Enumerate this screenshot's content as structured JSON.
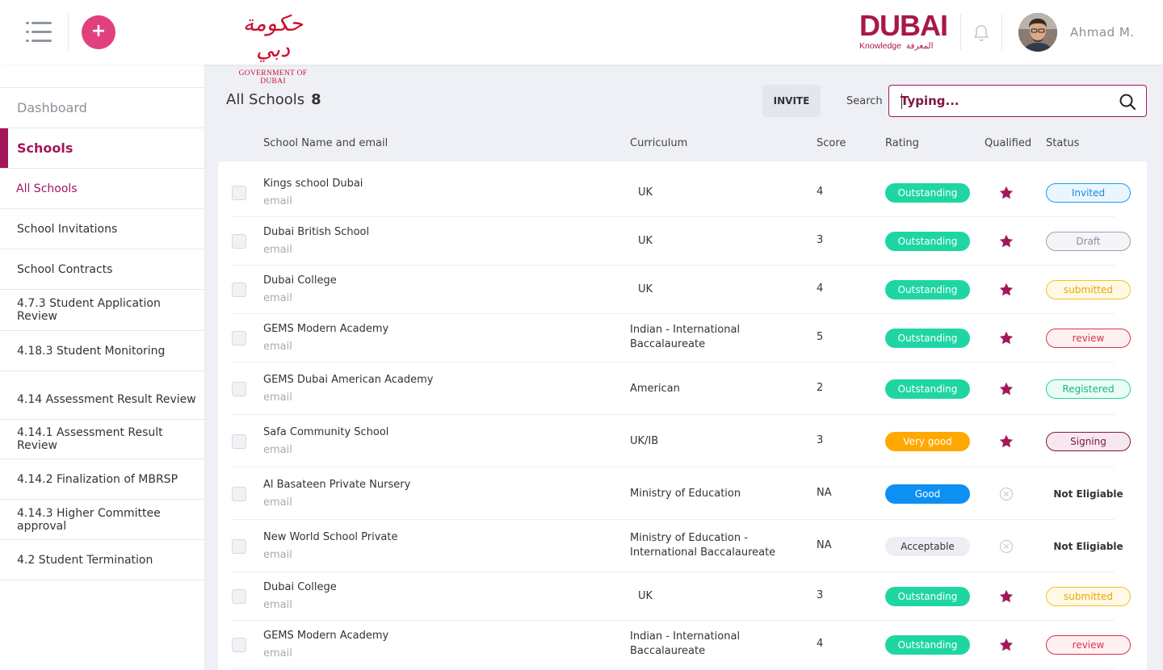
{
  "header": {
    "gov_logo_arabic": "حكومة دبي",
    "gov_logo_text": "GOVERNMENT OF DUBAI",
    "dubai_logo_text": "DUBAI",
    "dubai_logo_sub_en": "Knowledge",
    "dubai_logo_sub_ar": "المعرفة",
    "user_name": "Ahmad M.",
    "add_label": "+"
  },
  "sidebar": {
    "dashboard": "Dashboard",
    "schools": "Schools",
    "items": [
      "All Schools",
      "School Invitations",
      "School Contracts",
      "4.7.3 Student Application Review",
      "4.18.3 Student Monitoring",
      "4.14 Assessment Result Review",
      "4.14.1 Assessment Result Review",
      "4.14.2 Finalization of MBRSP",
      "4.14.3 Higher Committee approval",
      "4.2 Student Termination"
    ]
  },
  "main": {
    "title": "All Schools",
    "count": "8",
    "invite_label": "INVITE",
    "search_label": "Search",
    "search_placeholder": "Typing...",
    "columns": [
      "School Name and email",
      "Curriculum",
      "Score",
      "Rating",
      "Qualified",
      "Status"
    ]
  },
  "colors": {
    "accent": "#a3165a",
    "add_button": "#e0417e",
    "outstanding": "#1fd6a2",
    "very_good": "#ffa800",
    "good": "#0e8ff2",
    "acceptable": "#eceef4",
    "star": "#a3165a"
  },
  "rows": [
    {
      "name": "Kings school Dubai",
      "email": "email",
      "curriculum": "UK",
      "score": "4",
      "rating": "Outstanding",
      "qualified": "star",
      "status": "Invited"
    },
    {
      "name": "Dubai British School",
      "email": "email",
      "curriculum": "UK",
      "score": "3",
      "rating": "Outstanding",
      "qualified": "star",
      "status": "Draft"
    },
    {
      "name": "Dubai College",
      "email": "email",
      "curriculum": "UK",
      "score": "4",
      "rating": "Outstanding",
      "qualified": "star",
      "status": "submitted"
    },
    {
      "name": "GEMS Modern Academy",
      "email": "email",
      "curriculum": "Indian - International Baccalaureate",
      "score": "5",
      "rating": "Outstanding",
      "qualified": "star",
      "status": "review"
    },
    {
      "name": "GEMS Dubai American Academy",
      "email": "email",
      "curriculum": "American",
      "score": "2",
      "rating": "Outstanding",
      "qualified": "star",
      "status": "Registered"
    },
    {
      "name": "Safa Community School",
      "email": "email",
      "curriculum": "UK/IB",
      "score": "3",
      "rating": "Very good",
      "qualified": "star",
      "status": "Signing"
    },
    {
      "name": "Al Basateen Private Nursery",
      "email": "email",
      "curriculum": "Ministry of Education",
      "score": "NA",
      "rating": "Good",
      "qualified": "not-qualified",
      "status": "Not Eligiable"
    },
    {
      "name": "New World School Private",
      "email": "email",
      "curriculum": "Ministry of Education - International Baccalaureate",
      "score": "NA",
      "rating": "Acceptable",
      "qualified": "not-qualified",
      "status": "Not Eligiable"
    },
    {
      "name": "Dubai College",
      "email": "email",
      "curriculum": "UK",
      "score": "3",
      "rating": "Outstanding",
      "qualified": "star",
      "status": "submitted"
    },
    {
      "name": "GEMS Modern Academy",
      "email": "email",
      "curriculum": "Indian - International Baccalaureate",
      "score": "4",
      "rating": "Outstanding",
      "qualified": "star",
      "status": "review"
    }
  ]
}
